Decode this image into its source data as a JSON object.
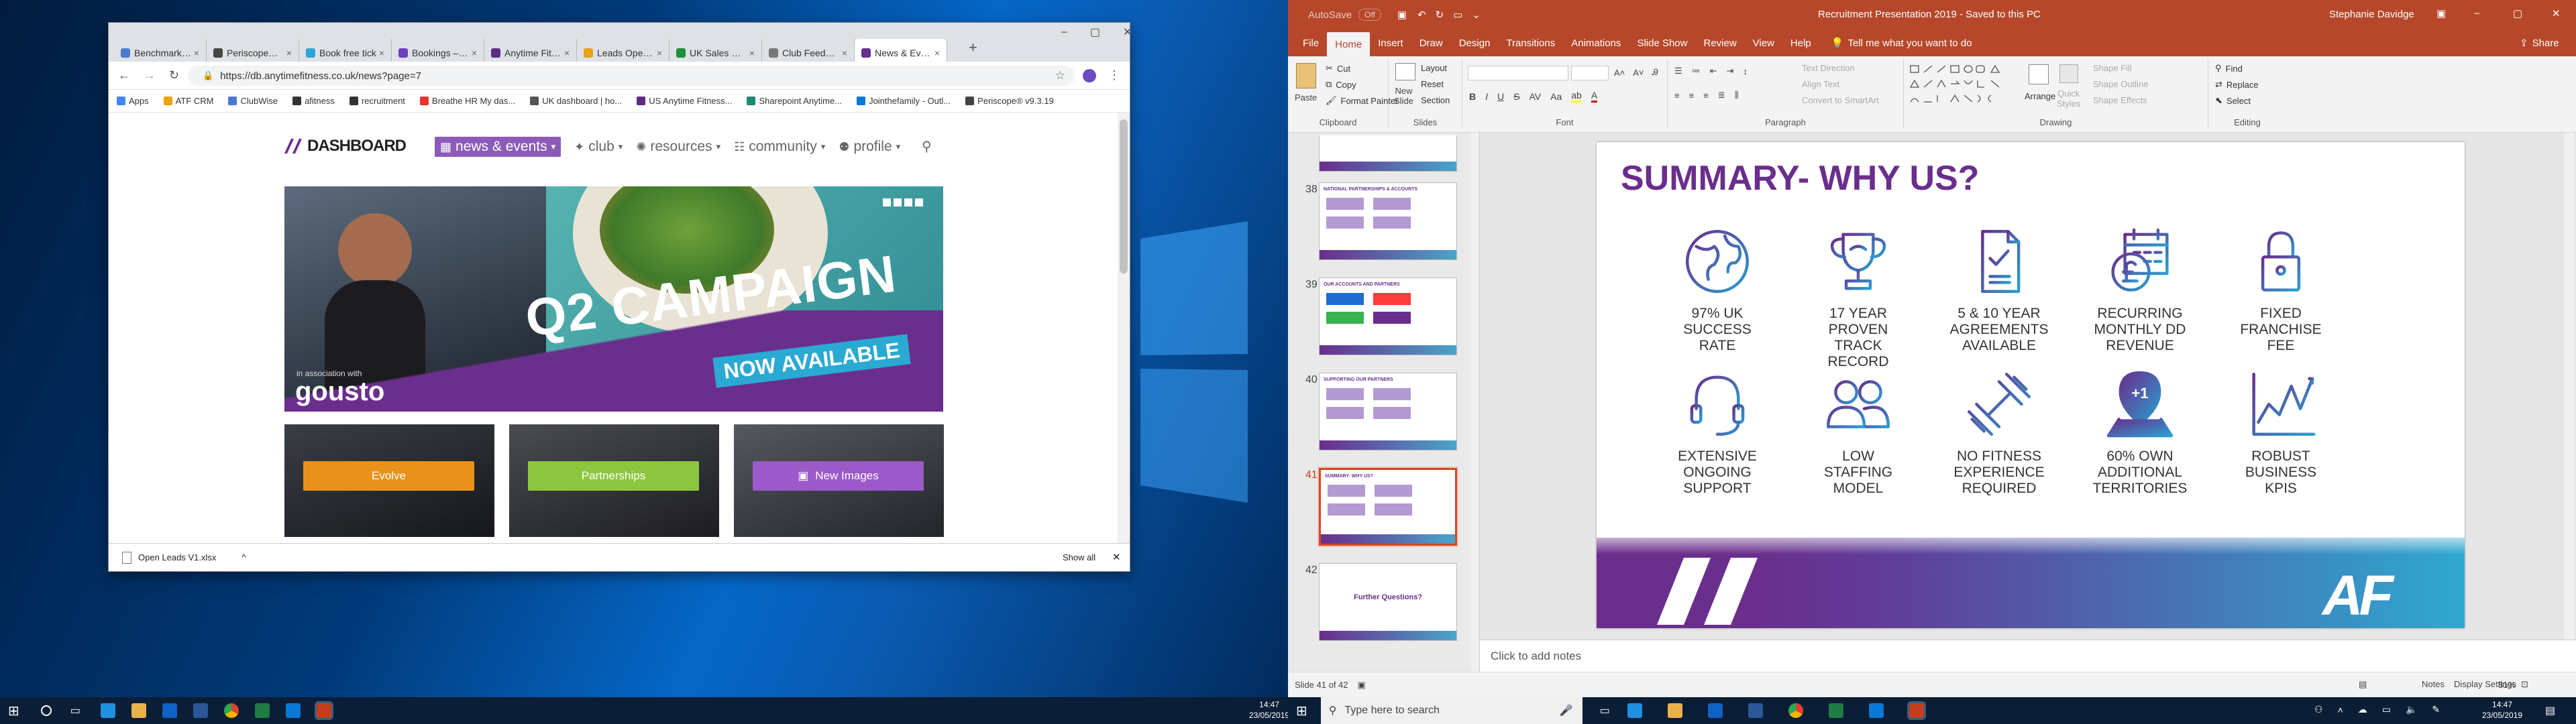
{
  "chrome": {
    "tabs": [
      {
        "label": "Benchmark Ex",
        "color": "#4a7ad0"
      },
      {
        "label": "Periscope® dt",
        "color": "#444"
      },
      {
        "label": "Book free tick",
        "color": "#2ca6d6"
      },
      {
        "label": "Bookings – dxs",
        "color": "#6d3fbf"
      },
      {
        "label": "Anytime Fitne",
        "color": "#5a2d82"
      },
      {
        "label": "Leads Open Le",
        "color": "#e8a317"
      },
      {
        "label": "UK Sales Repo",
        "color": "#1f8f3a"
      },
      {
        "label": "Club Feedback",
        "color": "#777"
      },
      {
        "label": "News & Events",
        "color": "#6a2e8c"
      }
    ],
    "url": "https://db.anytimefitness.co.uk/news?page=7",
    "bookmarks": [
      "Apps",
      "ATF CRM",
      "ClubWise",
      "afitness",
      "recruitment",
      "Breathe HR My das...",
      "UK dashboard | ho...",
      "US Anytime Fitness...",
      "Sharepoint Anytime...",
      "Jointhefamily - Outl...",
      "Periscope® v9.3.19"
    ],
    "download": {
      "file": "Open Leads V1.xlsx",
      "show_all": "Show all"
    },
    "window_buttons": [
      "–",
      "▢",
      "✕"
    ]
  },
  "site": {
    "logo": "DASHBOARD",
    "nav": [
      {
        "label": "news & events",
        "active": true
      },
      {
        "label": "club"
      },
      {
        "label": "resources"
      },
      {
        "label": "community"
      },
      {
        "label": "profile"
      }
    ],
    "hero": {
      "title": "Q2 CAMPAIGN",
      "subtitle": "NOW AVAILABLE",
      "small": "in association with",
      "brand": "gousto"
    },
    "tiles": [
      {
        "label": "Evolve",
        "color": "#e8921b"
      },
      {
        "label": "Partnerships",
        "color": "#8cc63f"
      },
      {
        "label": "New Images",
        "color": "#9b59c9"
      }
    ]
  },
  "taskbar_left": {
    "time": "14:47",
    "date": "23/05/2019"
  },
  "ppt": {
    "autosave": "AutoSave",
    "autosave_state": "Off",
    "title": "Recruitment Presentation 2019  -  Saved to this PC",
    "user": "Stephanie Davidge",
    "tabs": [
      "File",
      "Home",
      "Insert",
      "Draw",
      "Design",
      "Transitions",
      "Animations",
      "Slide Show",
      "Review",
      "View",
      "Help"
    ],
    "tell": "Tell me what you want to do",
    "share": "Share",
    "ribbon": {
      "clipboard": {
        "label": "Clipboard",
        "paste": "Paste",
        "cut": "Cut",
        "copy": "Copy",
        "painter": "Format Painter"
      },
      "slides": {
        "label": "Slides",
        "new": "New\nSlide",
        "layout": "Layout",
        "reset": "Reset",
        "section": "Section"
      },
      "font": {
        "label": "Font"
      },
      "paragraph": {
        "label": "Paragraph",
        "dir": "Text Direction",
        "align": "Align Text",
        "smart": "Convert to SmartArt"
      },
      "drawing": {
        "label": "Drawing",
        "arrange": "Arrange",
        "quick": "Quick\nStyles",
        "fill": "Shape Fill",
        "outline": "Shape Outline",
        "effects": "Shape Effects"
      },
      "editing": {
        "label": "Editing",
        "find": "Find",
        "replace": "Replace",
        "select": "Select"
      }
    },
    "thumbs": [
      {
        "num": "38",
        "title": "NATIONAL PARTNERSHIPS & ACCOUNTS"
      },
      {
        "num": "39",
        "title": "OUR ACCOUNTS AND PARTNERS"
      },
      {
        "num": "40",
        "title": "SUPPORTING OUR PARTNERS"
      },
      {
        "num": "41",
        "title": "SUMMARY- WHY US?",
        "selected": true
      },
      {
        "num": "42",
        "title": "Further Questions?"
      }
    ],
    "slide": {
      "title": "SUMMARY- WHY US?",
      "items": [
        {
          "icon": "globe-icon",
          "label": "97% UK\nSUCCESS\nRATE"
        },
        {
          "icon": "trophy-icon",
          "label": "17 YEAR\nPROVEN TRACK\nRECORD"
        },
        {
          "icon": "document-icon",
          "label": "5 & 10 YEAR\nAGREEMENTS\nAVAILABLE"
        },
        {
          "icon": "calendar-pound-icon",
          "label": "RECURRING\nMONTHLY DD\nREVENUE"
        },
        {
          "icon": "padlock-icon",
          "label": "FIXED\nFRANCHISE\nFEE"
        },
        {
          "icon": "headset-icon",
          "label": "EXTENSIVE\nONGOING\nSUPPORT"
        },
        {
          "icon": "users-icon",
          "label": "LOW\nSTAFFING\nMODEL"
        },
        {
          "icon": "dumbbell-icon",
          "label": "NO FITNESS\nEXPERIENCE\nREQUIRED"
        },
        {
          "icon": "map-pin-icon",
          "label": "60% OWN\nADDITIONAL\nTERRITORIES"
        },
        {
          "icon": "chart-icon",
          "label": "ROBUST\nBUSINESS\nKPIS"
        }
      ],
      "pin_text": "+1",
      "logo": "AF"
    },
    "notes_placeholder": "Click to add notes",
    "status": {
      "slide": "Slide 41 of 42",
      "notes": "Notes",
      "display": "Display Settings",
      "zoom": "81%"
    }
  },
  "taskbar_right": {
    "search": "Type here to search",
    "time": "14:47",
    "date": "23/05/2019"
  },
  "colors": {
    "purple": "#6a2e8c",
    "teal": "#2a9fd0",
    "ppt_red": "#b7472a"
  }
}
